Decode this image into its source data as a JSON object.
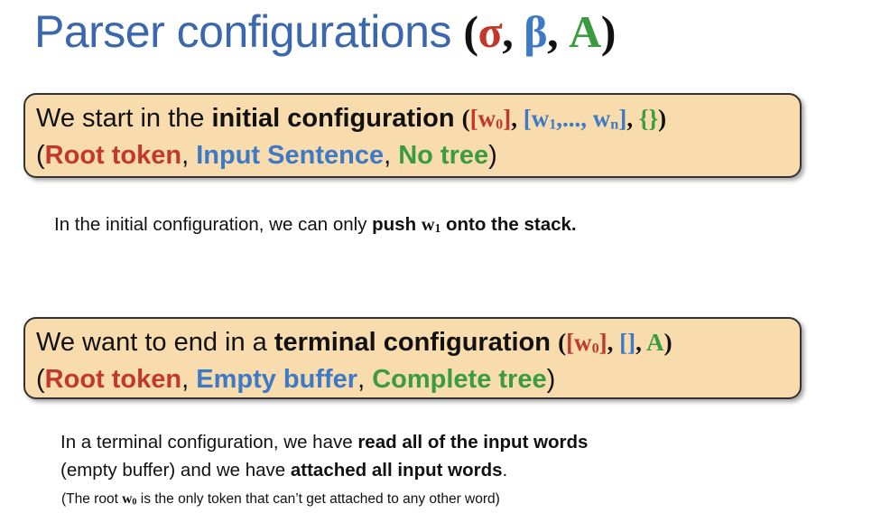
{
  "title": {
    "text": "Parser configurations",
    "tuple": {
      "open": "(",
      "sigma": "σ",
      "comma1": ",",
      "beta": "β",
      "comma2": ",",
      "a": "A",
      "close": ")"
    }
  },
  "initial_box": {
    "line1_prefix": "We start in the ",
    "line1_bold": "initial configuration",
    "tuple": {
      "open": "(",
      "stack_open": "[w",
      "stack_sub": "0",
      "stack_close": "]",
      "sep1": ", ",
      "buffer_open": "[w",
      "buffer_sub1": "1",
      "buffer_mid": ",..., w",
      "buffer_subn": "n",
      "buffer_close": "]",
      "sep2": ", ",
      "arcs": "{}",
      "close": ")"
    },
    "line2": {
      "open": "(",
      "root": "Root token",
      "comma1": ", ",
      "input": "Input Sentence",
      "comma2": ", ",
      "tree": "No tree",
      "close": ")"
    }
  },
  "initial_note": {
    "prefix": "In the initial configuration, we can only ",
    "bold_push": "push ",
    "w": "w",
    "w_sub": "1",
    "bold_tail": " onto the stack."
  },
  "terminal_box": {
    "line1_prefix": "We want to end in a ",
    "line1_bold": "terminal configuration",
    "tuple": {
      "open": "(",
      "stack_open": "[w",
      "stack_sub": "0",
      "stack_close": "]",
      "sep1": ", ",
      "buffer": "[]",
      "sep2": ", ",
      "arcs": "A",
      "close": ")"
    },
    "line2": {
      "open": "(",
      "root": "Root token",
      "comma1": ", ",
      "buffer": "Empty buffer",
      "comma2": ", ",
      "tree": "Complete tree",
      "close": ")"
    }
  },
  "terminal_note": {
    "line1_prefix": "In a terminal configuration, we have ",
    "line1_bold": "read all of the input words",
    "line2_prefix": "(empty buffer) and we have ",
    "line2_bold": "attached all input words",
    "line2_suffix": ".",
    "footnote_prefix": "(The root ",
    "footnote_w": "w",
    "footnote_w_sub": "0",
    "footnote_suffix": " is the only token that can’t get attached to any other word)"
  },
  "colors": {
    "title": "#3a67ad",
    "root": "#c0392b",
    "buffer": "#3d79c4",
    "tree": "#3a9b3f",
    "box_fill": "#f8dcae"
  }
}
